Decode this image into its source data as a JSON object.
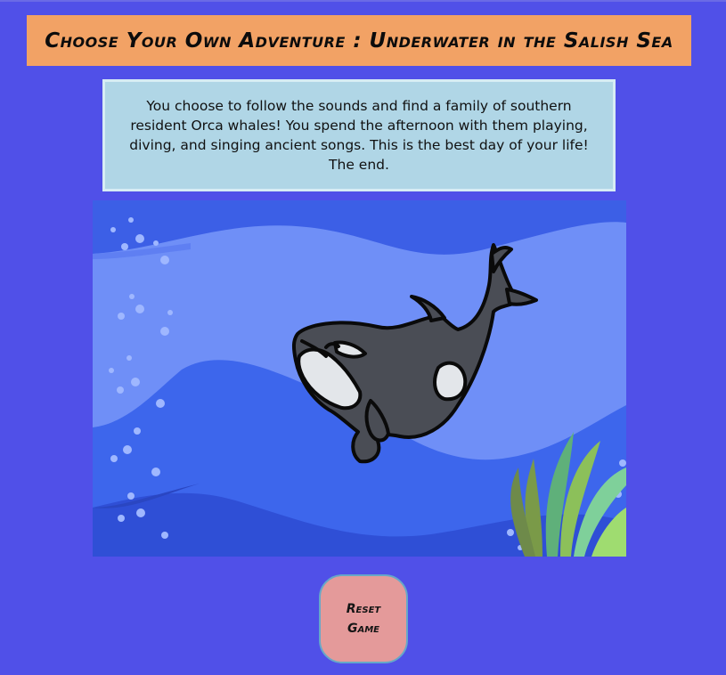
{
  "header": {
    "title": "Choose Your Own Adventure : Underwater in the Salish Sea"
  },
  "story": {
    "text": "You choose to follow the sounds and find a family of southern resident Orca whales! You spend the afternoon with them playing, diving, and singing ancient songs. This is the best day of your life! The end."
  },
  "scene": {
    "image_subject": "orca-whale-underwater-illustration"
  },
  "controls": {
    "reset_label": "Reset Game"
  },
  "colors": {
    "page_background": "#5050e8",
    "title_background": "#f2a265",
    "story_background": "#b0d6e6",
    "button_background": "#e49a9a"
  }
}
